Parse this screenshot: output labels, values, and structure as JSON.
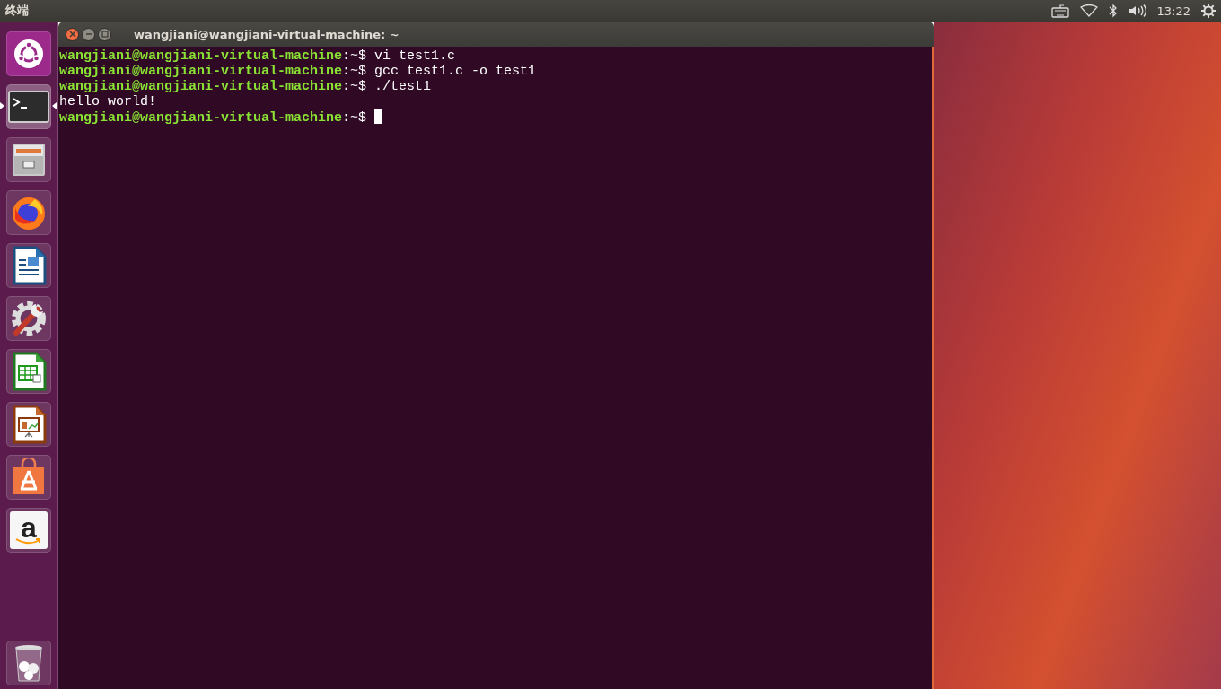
{
  "top_bar": {
    "app_title": "终端",
    "clock": "13:22"
  },
  "launcher": {
    "items": [
      {
        "kind": "dash",
        "selected": false
      },
      {
        "kind": "terminal",
        "selected": true
      },
      {
        "kind": "files",
        "selected": false
      },
      {
        "kind": "browser",
        "selected": false
      },
      {
        "kind": "writer",
        "selected": false
      },
      {
        "kind": "settings",
        "selected": false
      },
      {
        "kind": "calc",
        "selected": false
      },
      {
        "kind": "impress",
        "selected": false
      },
      {
        "kind": "store",
        "selected": false
      },
      {
        "kind": "amazon",
        "selected": false,
        "glyph": "a"
      }
    ],
    "trash": {
      "kind": "trash"
    }
  },
  "window": {
    "title": "wangjiani@wangjiani-virtual-machine: ~"
  },
  "terminal": {
    "lines": [
      {
        "kind": "prompt",
        "user_host": "wangjiani@wangjiani-virtual-machine",
        "path": ":~$",
        "command": "vi test1.c",
        "cursor": false
      },
      {
        "kind": "prompt",
        "user_host": "wangjiani@wangjiani-virtual-machine",
        "path": ":~$",
        "command": "gcc test1.c -o test1",
        "cursor": false
      },
      {
        "kind": "prompt",
        "user_host": "wangjiani@wangjiani-virtual-machine",
        "path": ":~$",
        "command": "./test1",
        "cursor": false
      },
      {
        "kind": "output",
        "text": "hello world!"
      },
      {
        "kind": "prompt",
        "user_host": "wangjiani@wangjiani-virtual-machine",
        "path": ":~$",
        "cursor": true
      }
    ]
  }
}
